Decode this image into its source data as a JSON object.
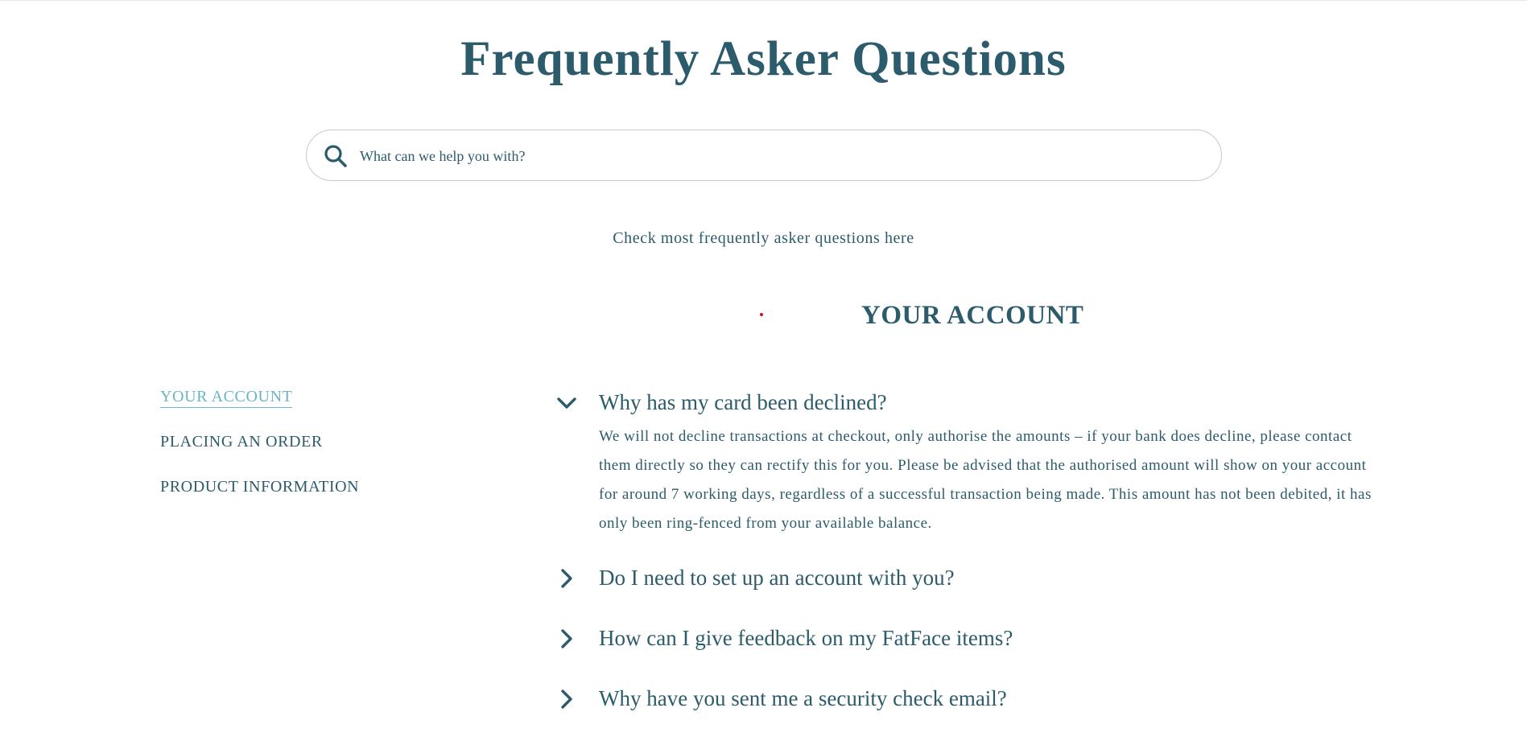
{
  "page": {
    "title": "Frequently Asker Questions",
    "subtitle": "Check most frequently asker questions here"
  },
  "search": {
    "placeholder": "What can we help you with?",
    "icon": "search-icon"
  },
  "section": {
    "title": "YOUR ACCOUNT"
  },
  "sidebar": {
    "items": [
      {
        "label": "YOUR ACCOUNT",
        "active": true
      },
      {
        "label": "PLACING AN ORDER",
        "active": false
      },
      {
        "label": "PRODUCT INFORMATION",
        "active": false
      }
    ]
  },
  "faq": {
    "items": [
      {
        "question": "Why has my card been declined?",
        "expanded": true,
        "answer": "We will not decline transactions at checkout, only authorise the amounts – if your bank does decline, please contact them directly so they can rectify this for you. Please be advised that the authorised amount will show on your account for around 7 working days, regardless of a successful transaction being made. This amount has not been debited, it has only been ring-fenced from your available balance."
      },
      {
        "question": "Do I need to set up an account with you?",
        "expanded": false
      },
      {
        "question": "How can I give feedback on my FatFace items?",
        "expanded": false
      },
      {
        "question": "Why have you sent me a security check email?",
        "expanded": false
      }
    ]
  },
  "colors": {
    "primary": "#2c5b6b",
    "active": "#6ab3c9",
    "border": "#c9c9c9",
    "accent_dot": "#d0141b"
  }
}
